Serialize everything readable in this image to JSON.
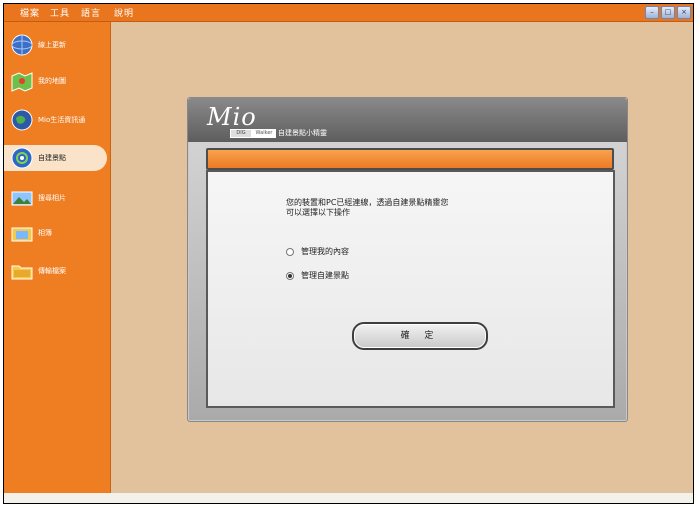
{
  "menubar": {
    "items": [
      {
        "label": "檔案"
      },
      {
        "label": "工具"
      },
      {
        "label": "語言"
      },
      {
        "label": "說明"
      }
    ]
  },
  "window_controls": {
    "min_icon": "minimize-icon",
    "max_icon": "maximize-icon",
    "close_icon": "close-icon"
  },
  "sidebar": {
    "items": [
      {
        "label": "線上更新",
        "icon": "globe-icon"
      },
      {
        "label": "我的地圖",
        "icon": "map-icon"
      },
      {
        "label": "Mio生活資訊通",
        "icon": "info-globe-icon"
      },
      {
        "label": "自建景點",
        "icon": "poi-icon",
        "selected": true
      },
      {
        "label": "搜尋相片",
        "icon": "photo-search-icon"
      },
      {
        "label": "相簿",
        "icon": "album-icon"
      },
      {
        "label": "傳輸檔案",
        "icon": "folder-icon"
      }
    ]
  },
  "dialog": {
    "logo": "Mio",
    "badge1": "DIG",
    "badge2": "Walker",
    "subtitle": "自建景點小精靈",
    "message_line1": "您的裝置和PC已經連線，透過自建景點精靈您",
    "message_line2": "可以選擇以下操作",
    "options": [
      {
        "label": "管理我的內容",
        "checked": false
      },
      {
        "label": "管理自建景點",
        "checked": true
      }
    ],
    "ok_label": "確 定"
  },
  "colors": {
    "accent_orange": "#ef7d22",
    "content_bg": "#e2c29d"
  }
}
